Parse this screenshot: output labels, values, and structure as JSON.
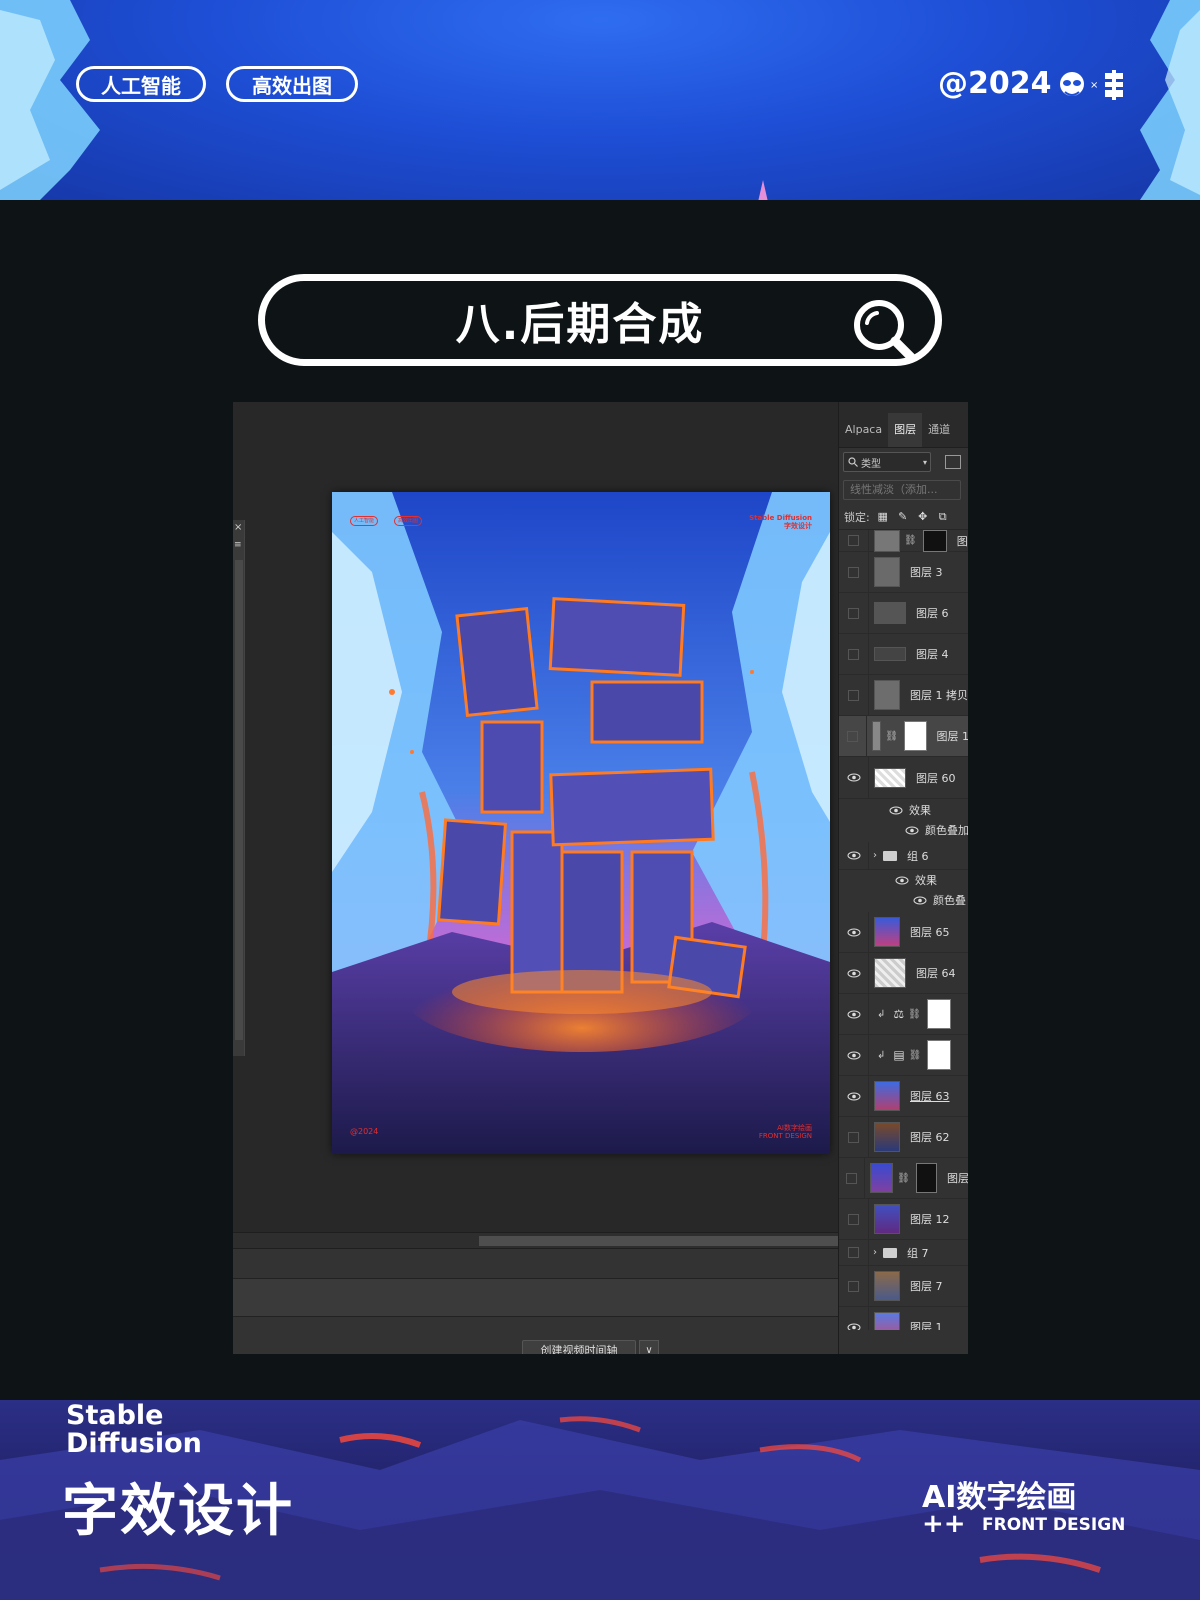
{
  "header": {
    "tag_1": "人工智能",
    "tag_2": "高效出图",
    "year": "@2024",
    "brand_x": "×"
  },
  "title": {
    "text": "八.后期合成"
  },
  "artwork": {
    "tag_1": "人工智能",
    "tag_2": "高效出图",
    "corner_line1": "Stable Diffusion",
    "corner_line2": "字效设计",
    "bottom_left": "@2024",
    "bottom_right_line1": "AI数字绘画",
    "bottom_right_line2": "FRONT DESIGN"
  },
  "timeline": {
    "button_label": "创建视频时间轴",
    "dropdown_glyph": "∨"
  },
  "panel": {
    "tabs": [
      "Alpaca",
      "图层",
      "通道"
    ],
    "filter_label": "类型",
    "blend_mode": "线性减淡（添加...",
    "lock_label": "锁定:"
  },
  "layers": [
    {
      "name": "图",
      "visible": false
    },
    {
      "name": "图层 3",
      "visible": false
    },
    {
      "name": "图层 6",
      "visible": false
    },
    {
      "name": "图层 4",
      "visible": false
    },
    {
      "name": "图层 1 拷贝",
      "visible": false
    },
    {
      "name": "图层 1",
      "visible": false
    },
    {
      "name": "图层 60",
      "visible": true
    },
    {
      "name": "效果",
      "visible": true
    },
    {
      "name": "颜色叠加",
      "visible": true
    },
    {
      "name": "组 6",
      "visible": true
    },
    {
      "name": "效果",
      "visible": true
    },
    {
      "name": "颜色叠",
      "visible": true
    },
    {
      "name": "图层 65",
      "visible": true
    },
    {
      "name": "图层 64",
      "visible": true
    },
    {
      "name": "",
      "visible": true
    },
    {
      "name": "",
      "visible": true
    },
    {
      "name": "图层 63",
      "visible": true
    },
    {
      "name": "图层 62",
      "visible": false
    },
    {
      "name": "图层",
      "visible": false
    },
    {
      "name": "图层 12",
      "visible": false
    },
    {
      "name": "组 7",
      "visible": false
    },
    {
      "name": "图层 7",
      "visible": false
    },
    {
      "name": "图层 1",
      "visible": true
    }
  ],
  "footer": {
    "stable_line1": "Stable",
    "stable_line2": "Diffusion",
    "big_title": "字效设计",
    "ai_title": "AI数字绘画",
    "plus": "++",
    "front_design": "FRONT DESIGN"
  },
  "colors": {
    "banner_blue": "#1e4fd6",
    "page_dark": "#0e1416",
    "ps_bg": "#282828",
    "panel_bg": "#323232",
    "accent_red": "#e03030"
  }
}
